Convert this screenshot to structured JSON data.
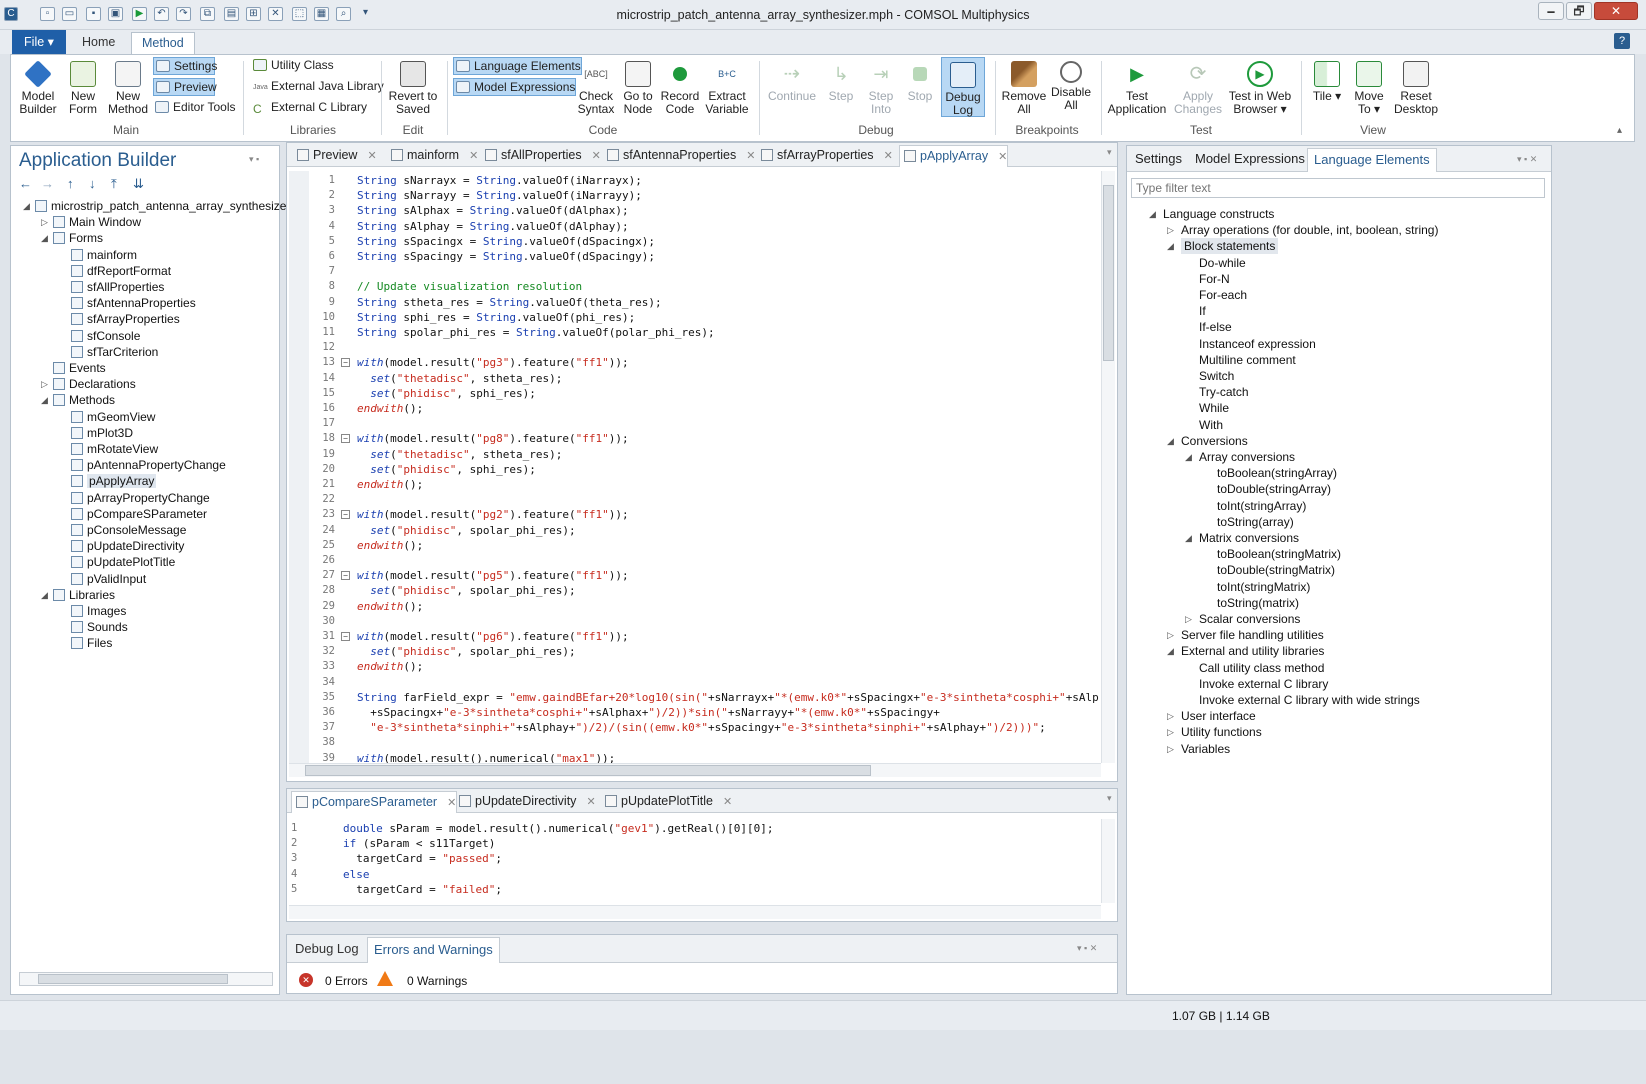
{
  "window": {
    "title": "microstrip_patch_antenna_array_synthesizer.mph - COMSOL Multiphysics",
    "min": "🗕",
    "max": "🗗",
    "close": "✕"
  },
  "menu": {
    "file": "File ▾",
    "tabs": [
      "Home",
      "Method"
    ],
    "help": "?"
  },
  "ribbon": {
    "main": {
      "model_builder": "Model Builder",
      "new_form": "New Form",
      "new_method": "New Method",
      "settings": "Settings",
      "preview": "Preview",
      "editor_tools": "Editor Tools",
      "label": "Main"
    },
    "libraries": {
      "utility_class": "Utility Class",
      "java_lib": "External Java Library",
      "c_lib": "External C Library",
      "java_tag": "Java",
      "label": "Libraries"
    },
    "edit": {
      "revert": "Revert to Saved",
      "label": "Edit"
    },
    "code": {
      "language_elements": "Language Elements",
      "model_expressions": "Model Expressions",
      "check_syntax": "Check Syntax",
      "go_to_node": "Go to Node",
      "record_code": "Record Code",
      "extract_variable": "Extract Variable",
      "label": "Code"
    },
    "debug": {
      "continue": "Continue",
      "step": "Step",
      "step_into": "Step Into",
      "stop": "Stop",
      "debug_log": "Debug Log",
      "label": "Debug"
    },
    "breakpoints": {
      "remove_all": "Remove All",
      "disable_all": "Disable All",
      "label": "Breakpoints"
    },
    "test": {
      "test_application": "Test Application",
      "apply_changes": "Apply Changes",
      "test_web": "Test in Web Browser ▾",
      "label": "Test"
    },
    "view": {
      "tile": "Tile ▾",
      "move_to": "Move To ▾",
      "reset_desktop": "Reset Desktop",
      "label": "View"
    }
  },
  "app_builder": {
    "title": "Application Builder",
    "toolbar_icons": [
      "←",
      "→",
      "↑",
      "↓",
      "⤒",
      "⇊"
    ],
    "tree": [
      {
        "label": "microstrip_patch_antenna_array_synthesizer",
        "level": 0,
        "exp": "◢"
      },
      {
        "label": "Main Window",
        "level": 1,
        "exp": "▷"
      },
      {
        "label": "Forms",
        "level": 1,
        "exp": "◢"
      },
      {
        "label": "mainform",
        "level": 2
      },
      {
        "label": "dfReportFormat",
        "level": 2
      },
      {
        "label": "sfAllProperties",
        "level": 2
      },
      {
        "label": "sfAntennaProperties",
        "level": 2
      },
      {
        "label": "sfArrayProperties",
        "level": 2
      },
      {
        "label": "sfConsole",
        "level": 2
      },
      {
        "label": "sfTarCriterion",
        "level": 2
      },
      {
        "label": "Events",
        "level": 1
      },
      {
        "label": "Declarations",
        "level": 1,
        "exp": "▷"
      },
      {
        "label": "Methods",
        "level": 1,
        "exp": "◢"
      },
      {
        "label": "mGeomView",
        "level": 2
      },
      {
        "label": "mPlot3D",
        "level": 2
      },
      {
        "label": "mRotateView",
        "level": 2
      },
      {
        "label": "pAntennaPropertyChange",
        "level": 2
      },
      {
        "label": "pApplyArray",
        "level": 2,
        "sel": true
      },
      {
        "label": "pArrayPropertyChange",
        "level": 2
      },
      {
        "label": "pCompareSParameter",
        "level": 2
      },
      {
        "label": "pConsoleMessage",
        "level": 2
      },
      {
        "label": "pUpdateDirectivity",
        "level": 2
      },
      {
        "label": "pUpdatePlotTitle",
        "level": 2
      },
      {
        "label": "pValidInput",
        "level": 2
      },
      {
        "label": "Libraries",
        "level": 1,
        "exp": "◢"
      },
      {
        "label": "Images",
        "level": 2
      },
      {
        "label": "Sounds",
        "level": 2
      },
      {
        "label": "Files",
        "level": 2
      }
    ]
  },
  "editor": {
    "tabs": [
      {
        "label": "Preview",
        "active": false
      },
      {
        "label": "mainform",
        "active": false
      },
      {
        "label": "sfAllProperties",
        "active": false
      },
      {
        "label": "sfAntennaProperties",
        "active": false
      },
      {
        "label": "sfArrayProperties",
        "active": false
      },
      {
        "label": "pApplyArray",
        "active": true
      }
    ],
    "lines": [
      "String sNarrayx = String.valueOf(iNarrayx);",
      "String sNarrayy = String.valueOf(iNarrayy);",
      "String sAlphax = String.valueOf(dAlphax);",
      "String sAlphay = String.valueOf(dAlphay);",
      "String sSpacingx = String.valueOf(dSpacingx);",
      "String sSpacingy = String.valueOf(dSpacingy);",
      "",
      "// Update visualization resolution",
      "String stheta_res = String.valueOf(theta_res);",
      "String sphi_res = String.valueOf(phi_res);",
      "String spolar_phi_res = String.valueOf(polar_phi_res);",
      "",
      "with(model.result(\"pg3\").feature(\"ff1\"));",
      "  set(\"thetadisc\", stheta_res);",
      "  set(\"phidisc\", sphi_res);",
      "endwith();",
      "",
      "with(model.result(\"pg8\").feature(\"ff1\"));",
      "  set(\"thetadisc\", stheta_res);",
      "  set(\"phidisc\", sphi_res);",
      "endwith();",
      "",
      "with(model.result(\"pg2\").feature(\"ff1\"));",
      "  set(\"phidisc\", spolar_phi_res);",
      "endwith();",
      "",
      "with(model.result(\"pg5\").feature(\"ff1\"));",
      "  set(\"phidisc\", spolar_phi_res);",
      "endwith();",
      "",
      "with(model.result(\"pg6\").feature(\"ff1\"));",
      "  set(\"phidisc\", spolar_phi_res);",
      "endwith();",
      "",
      "String farField_expr = \"emw.gaindBEfar+20*log10(sin(\"+sNarrayx+\"*(emw.k0*\"+sSpacingx+\"e-3*sintheta*cosphi+\"+sAlp",
      "  +sSpacingx+\"e-3*sintheta*cosphi+\"+sAlphax+\")/2))*sin(\"+sNarrayy+\"*(emw.k0*\"+sSpacingy+",
      "  \"e-3*sintheta*sinphi+\"+sAlphay+\")/2)/(sin((emw.k0*\"+sSpacingy+\"e-3*sintheta*sinphi+\"+sAlphay+\")/2)))\";",
      "",
      "with(model.result().numerical(\"max1\"));"
    ]
  },
  "editor2": {
    "tabs": [
      {
        "label": "pCompareSParameter",
        "active": true
      },
      {
        "label": "pUpdateDirectivity",
        "active": false
      },
      {
        "label": "pUpdatePlotTitle",
        "active": false
      }
    ],
    "lines": [
      "double sParam = model.result().numerical(\"gev1\").getReal()[0][0];",
      "if (sParam < s11Target)",
      "  targetCard = \"passed\";",
      "else",
      "  targetCard = \"failed\";"
    ]
  },
  "debug_panel": {
    "tabs": [
      "Debug Log",
      "Errors and Warnings"
    ],
    "errors": "0 Errors",
    "warnings": "0 Warnings"
  },
  "right_panel": {
    "tabs": [
      "Settings",
      "Model Expressions",
      "Language Elements"
    ],
    "filter_placeholder": "Type filter text",
    "tree": [
      {
        "label": "Language constructs",
        "level": 0,
        "exp": "◢"
      },
      {
        "label": "Array operations (for double, int, boolean, string)",
        "level": 1,
        "exp": "▷"
      },
      {
        "label": "Block statements",
        "level": 1,
        "exp": "◢",
        "sel": true
      },
      {
        "label": "Do-while",
        "level": 2
      },
      {
        "label": "For-N",
        "level": 2
      },
      {
        "label": "For-each",
        "level": 2
      },
      {
        "label": "If",
        "level": 2
      },
      {
        "label": "If-else",
        "level": 2
      },
      {
        "label": "Instanceof expression",
        "level": 2
      },
      {
        "label": "Multiline comment",
        "level": 2
      },
      {
        "label": "Switch",
        "level": 2
      },
      {
        "label": "Try-catch",
        "level": 2
      },
      {
        "label": "While",
        "level": 2
      },
      {
        "label": "With",
        "level": 2
      },
      {
        "label": "Conversions",
        "level": 1,
        "exp": "◢"
      },
      {
        "label": "Array conversions",
        "level": 2,
        "exp": "◢"
      },
      {
        "label": "toBoolean(stringArray)",
        "level": 3
      },
      {
        "label": "toDouble(stringArray)",
        "level": 3
      },
      {
        "label": "toInt(stringArray)",
        "level": 3
      },
      {
        "label": "toString(array)",
        "level": 3
      },
      {
        "label": "Matrix conversions",
        "level": 2,
        "exp": "◢"
      },
      {
        "label": "toBoolean(stringMatrix)",
        "level": 3
      },
      {
        "label": "toDouble(stringMatrix)",
        "level": 3
      },
      {
        "label": "toInt(stringMatrix)",
        "level": 3
      },
      {
        "label": "toString(matrix)",
        "level": 3
      },
      {
        "label": "Scalar conversions",
        "level": 2,
        "exp": "▷"
      },
      {
        "label": "Server file handling utilities",
        "level": 1,
        "exp": "▷"
      },
      {
        "label": "External and utility libraries",
        "level": 1,
        "exp": "◢"
      },
      {
        "label": "Call utility class method",
        "level": 2
      },
      {
        "label": "Invoke external C library",
        "level": 2
      },
      {
        "label": "Invoke external C library with wide strings",
        "level": 2
      },
      {
        "label": "User interface",
        "level": 1,
        "exp": "▷"
      },
      {
        "label": "Utility functions",
        "level": 1,
        "exp": "▷"
      },
      {
        "label": "Variables",
        "level": 1,
        "exp": "▷"
      }
    ]
  },
  "status": {
    "memory": "1.07 GB | 1.14 GB"
  },
  "colors": {
    "accent": "#2a5d8f",
    "file_button": "#1f5fa8",
    "keyword": "#1a3fb0",
    "string": "#c62b1e",
    "comment": "#168a23",
    "selection": "#b8d8f4"
  }
}
